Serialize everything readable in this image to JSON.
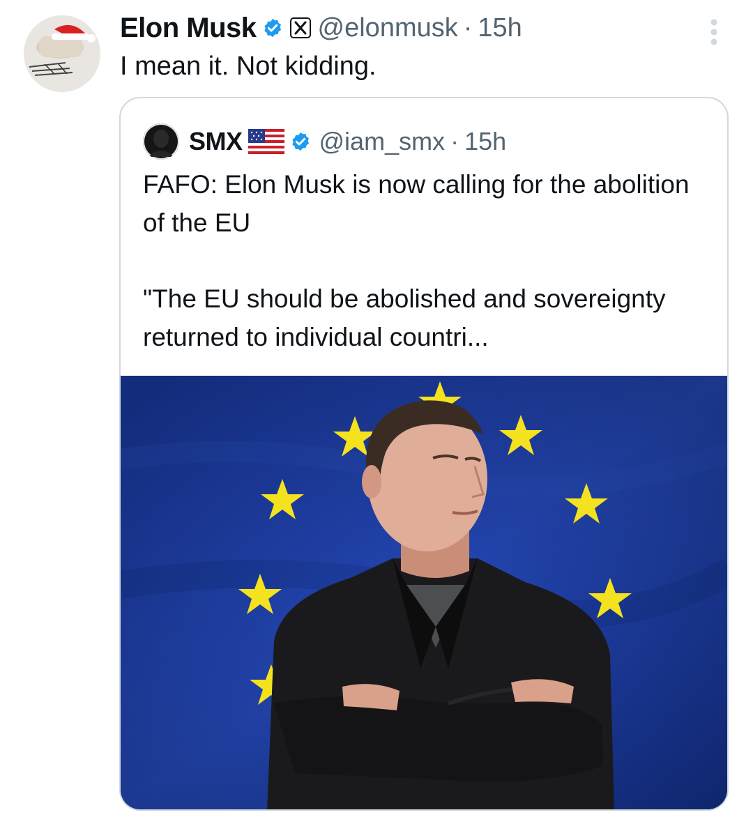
{
  "tweet": {
    "author_name": "Elon Musk",
    "handle": "@elonmusk",
    "separator": "·",
    "time": "15h",
    "text": "I mean it. Not kidding.",
    "avatar_icon": "santa-hat-avatar-icon",
    "verified_icon": "verified-badge-icon",
    "affiliate_icon": "x-logo-icon",
    "more_icon": "more-vertical-icon"
  },
  "quote": {
    "author_name": "SMX",
    "flag_icon": "us-flag-icon",
    "verified_icon": "verified-badge-icon",
    "handle": "@iam_smx",
    "separator": "·",
    "time": "15h",
    "text_line1": "FAFO: Elon Musk is now calling for the abolition of the EU",
    "text_line2": "\"The EU should be abolished and sovereignty returned to individual countri...",
    "media": "photo of man with crossed arms in front of EU flag"
  },
  "colors": {
    "text_primary": "#0f1419",
    "text_secondary": "#536471",
    "verified_blue": "#1d9bf0",
    "border": "#cfd9de",
    "eu_blue": "#1f3fa8",
    "eu_star": "#f5e21f"
  }
}
